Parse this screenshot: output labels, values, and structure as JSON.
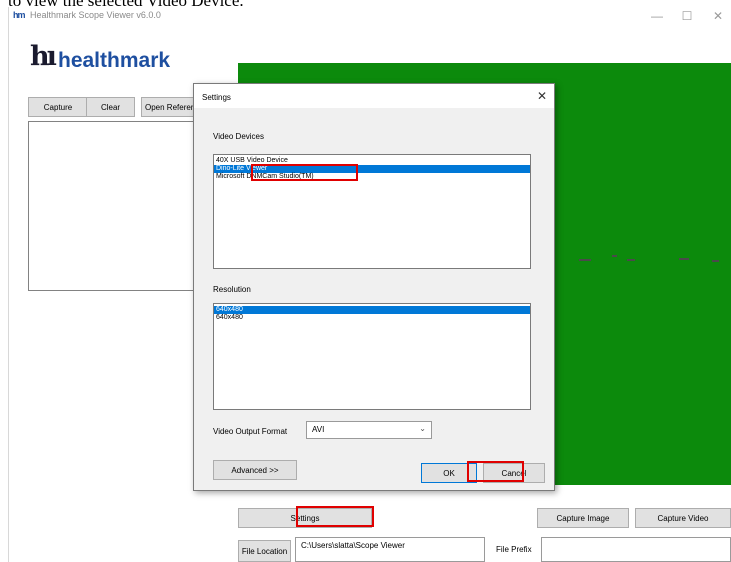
{
  "caption": "to view the selected Video Device.",
  "window": {
    "title": "Healthmark Scope Viewer v6.0.0",
    "app_icon": "hm",
    "controls": {
      "minimize": "—",
      "maximize": "☐",
      "close": "✕"
    }
  },
  "logo": {
    "mark": "hı",
    "text": "healthmark"
  },
  "toolbar": {
    "capture": "Capture",
    "clear": "Clear",
    "open_reference": "Open Reference"
  },
  "bottom": {
    "settings": "Settings",
    "capture_image": "Capture Image",
    "capture_video": "Capture Video",
    "file_location": "File Location",
    "file_location_value": "C:\\Users\\slatta\\Scope Viewer",
    "file_prefix_label": "File Prefix",
    "file_prefix_value": ""
  },
  "dialog": {
    "title": "Settings",
    "close": "✕",
    "video_devices_label": "Video Devices",
    "devices": [
      {
        "label": "40X USB Video Device",
        "selected": false
      },
      {
        "label": "Dino-Lite Viewer",
        "selected": true
      },
      {
        "label": "Microsoft DNMCam Studio(TM)",
        "selected": false
      }
    ],
    "resolution_label": "Resolution",
    "resolutions": [
      {
        "label": "640x480",
        "selected": true
      },
      {
        "label": "640x480",
        "selected": false
      }
    ],
    "output_format_label": "Video Output Format",
    "output_format_value": "AVI",
    "advanced": "Advanced >>",
    "ok": "OK",
    "cancel": "Cancel"
  },
  "colors": {
    "preview": "#0c8a0c",
    "highlight": "#e00000",
    "selection": "#0078d7",
    "brand": "#1e4fa0"
  },
  "icons": {
    "dropdown": "chevron-down-icon"
  }
}
